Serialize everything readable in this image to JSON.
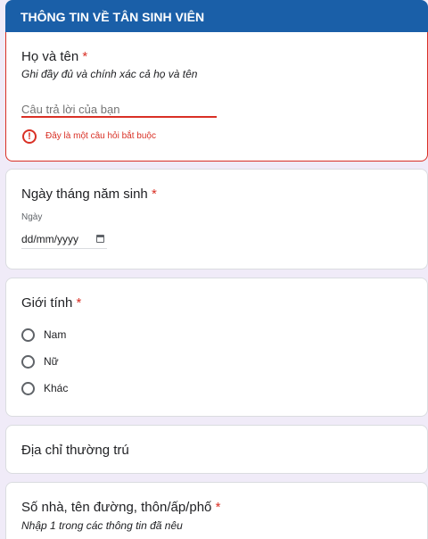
{
  "section": {
    "title": "THÔNG TIN VỀ TÂN SINH VIÊN"
  },
  "q_fullname": {
    "title": "Họ và tên",
    "required_mark": "*",
    "description": "Ghi đầy đủ và chính xác cả họ và tên",
    "placeholder": "Câu trả lời của bạn",
    "error_icon": "!",
    "error": "Đây là một câu hỏi bắt buộc"
  },
  "q_dob": {
    "title": "Ngày tháng năm sinh",
    "required_mark": "*",
    "date_label": "Ngày",
    "date_value": "dd/mm/yyyy",
    "icon": "calendar-icon"
  },
  "q_gender": {
    "title": "Giới tính",
    "required_mark": "*",
    "options": [
      "Nam",
      "Nữ",
      "Khác"
    ]
  },
  "q_address": {
    "title": "Địa chỉ thường trú"
  },
  "q_street": {
    "title": "Số nhà, tên đường, thôn/ấp/phố",
    "required_mark": "*",
    "description": "Nhập 1 trong các thông tin đã nêu"
  },
  "colors": {
    "header": "#1a5fa8",
    "error": "#d93025",
    "background": "#f0ebf8"
  }
}
